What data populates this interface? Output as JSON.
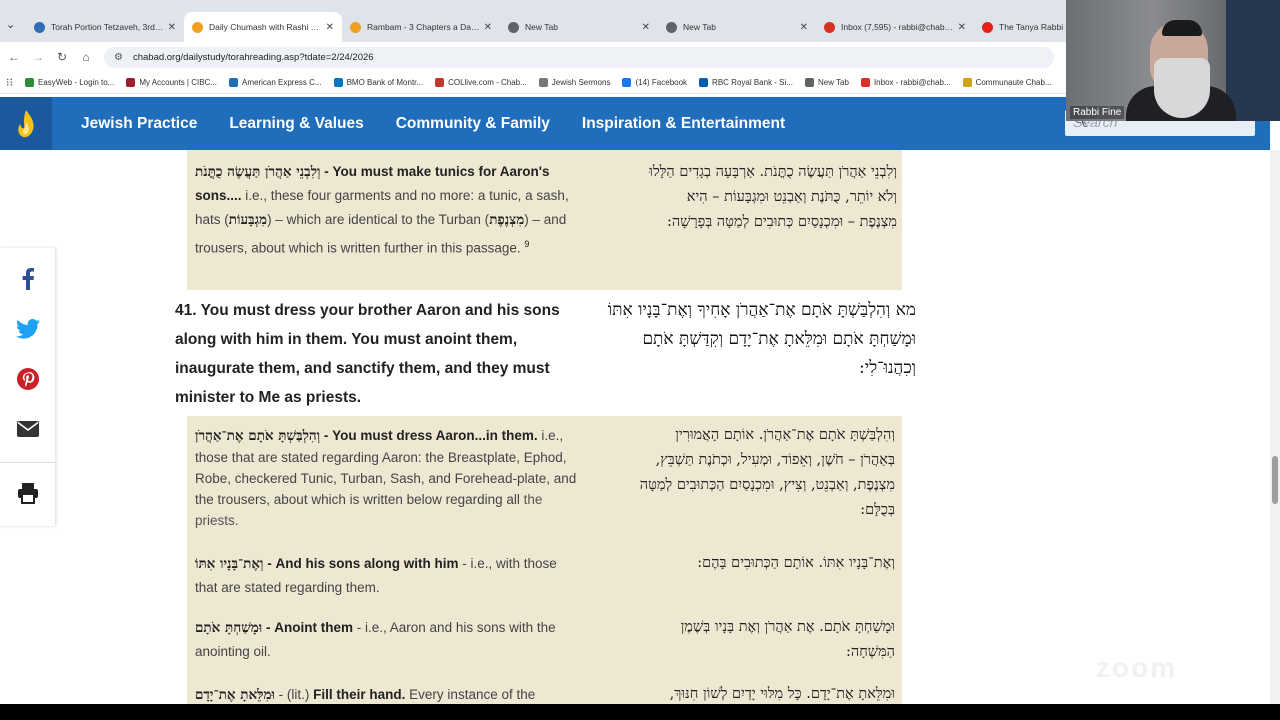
{
  "browser": {
    "tabs": [
      {
        "title": "Torah Portion Tetzaveh, 3rd Por",
        "fav_color": "#2f6db5",
        "active": false
      },
      {
        "title": "Daily Chumash with Rashi - Cha",
        "fav_color": "#f0a020",
        "active": true
      },
      {
        "title": "Rambam - 3 Chapters a Day - 1",
        "fav_color": "#f0a020",
        "active": false
      },
      {
        "title": "New Tab",
        "fav_color": "#5f6368",
        "active": false
      },
      {
        "title": "New Tab",
        "fav_color": "#5f6368",
        "active": false
      },
      {
        "title": "Inbox (7,595) - rabbi@chabad.",
        "fav_color": "#d93025",
        "active": false
      },
      {
        "title": "The Tanya Rabbi - Y",
        "fav_color": "#e62117",
        "active": false
      }
    ],
    "url": "chabad.org/dailystudy/torahreading.asp?tdate=2/24/2026",
    "bookmarks": [
      {
        "label": "EasyWeb - Login to...",
        "color": "#2e8b3b"
      },
      {
        "label": "My Accounts | CIBC...",
        "color": "#a01e2e"
      },
      {
        "label": "American Express C...",
        "color": "#1f6fb5"
      },
      {
        "label": "BMO Bank of Montr...",
        "color": "#0079c1"
      },
      {
        "label": "COLlive.com - Chab...",
        "color": "#c0392b"
      },
      {
        "label": "Jewish Sermons",
        "color": "#777777"
      },
      {
        "label": "(14) Facebook",
        "color": "#1877f2"
      },
      {
        "label": "RBC Royal Bank - Si...",
        "color": "#005daa"
      },
      {
        "label": "New Tab",
        "color": "#5f6368"
      },
      {
        "label": "Inbox - rabbi@chab...",
        "color": "#d93025"
      },
      {
        "label": "Communaute Chab...",
        "color": "#d4a017"
      }
    ]
  },
  "site": {
    "nav": [
      "Jewish Practice",
      "Learning & Values",
      "Community & Family",
      "Inspiration & Entertainment"
    ],
    "search_placeholder": "Search",
    "brand_color": "#1f6dbb"
  },
  "share": [
    "facebook-icon",
    "twitter-icon",
    "pinterest-icon",
    "email-icon",
    "print-icon"
  ],
  "content": {
    "c1_en_he": "וְלִבְנֵי אַהֲרֹן תַּעֲשֶׂה כֻתֳּנֹת",
    "c1_en_b": " - You must make tunics for Aaron's sons....",
    "c1_en_t1": " i.e., these four garments and no more: a tunic, a sash, hats (",
    "c1_en_he2": "מִגְבָּעוֹת",
    "c1_en_t2": ") – which are identical to the Turban (",
    "c1_en_he3": "מִצְנֶפֶת",
    "c1_en_t3": ") – and trousers, about which is written further in this passage.",
    "c1_en_fn": "9",
    "c1_he": "וְלִבְנֵי אַהֲרֹן תַּעֲשֶׂה כֻתֳּנֹת. אַרְבָּעָה בְגָדִים הַלָּלוּ וְלֹא יוֹתֵר, כֻּתֹּנֶת וְאַבְנֵט וּמִגְבָּעוֹת – הִיא מִצְנֶפֶת – וּמִכְנָסַיִם כְּתוּבִים לְמַטָּה בְּפָרָשָׁה:",
    "v41_en": "41.  You must dress your brother Aaron and his sons along with him in them. You must anoint them, inaugurate them, and sanctify them, and they must minister to Me as priests.",
    "v41_he": "מא  וְהִלְבַּשְׁתָּ אֹתָם אֶת־אַהֲרֹן אָחִיךָ וְאֶת־בָּנָיו אִתּוֹ וּמָשַׁחְתָּ אֹתָם וּמִלֵּאתָ אֶת־יָדָם וְקִדַּשְׁתָּ אֹתָם וְכִהֲנוּ־לִי:",
    "c2_en_he": "וְהִלְבַּשְׁתָּ אֹתָם אֶת־אַהֲרֹן",
    "c2_en_b": " - You must dress Aaron...in them.",
    "c2_en_t": " i.e., those that are stated regarding Aaron: the Breastplate, Ephod, Robe, checkered Tunic, Turban, Sash, and Forehead-plate, and the trousers, about which is written below regarding all",
    "c2_en_t2": " the priests.",
    "c2_he": "וְהִלְבַּשְׁתָּ אֹתָם אֶת־אַהֲרֹן. אוֹתָם הָאֲמוּרִין בְּאַהֲרֹן – חֹשֶׁן, וְאֵפוֹד, וּמְעִיל, וּכְתֹנֶת תַּשְׁבֵּץ, מִצְנֶפֶת, וְאַבְנֵט, וְצִיץ, וּמִכְנָסַיִם הַכְּתוּבִים לְמַטָּה בְּכֻלָּם:",
    "c3_en_he": "וְאֶת־בָּנָיו אִתּוֹ",
    "c3_en_b": " - And his sons along with him",
    "c3_en_t": " - i.e., with those that are stated regarding them.",
    "c3_he": "וְאֶת־בָּנָיו אִתּוֹ. אוֹתָם הַכְּתוּבִים בָּהֶם:",
    "c4_en_he": "וּמָשַׁחְתָּ אֹתָם",
    "c4_en_b": " - Anoint them",
    "c4_en_t": " - i.e., Aaron and his sons with the anointing oil.",
    "c4_he": "וּמָשַׁחְתָּ אֹתָם. אֶת אַהֲרֹן וְאֶת בָּנָיו בְּשֶׁמֶן הַמִּשְׁחָה:",
    "c5_en_he": "וּמִלֵּאתָ אֶת־יָדָם",
    "c5_en_t": " - (lit.) ",
    "c5_en_b": "Fill their hand.",
    "c5_en_t2": " Every instance of the",
    "c5_he": "וּמִלֵּאתָ אֶת־יָדָם. כָּל מִלּוּי יָדַיִם לְשׁוֹן חִנּוּךְ,"
  },
  "webcam": {
    "name": "Rabbi Fine"
  },
  "watermark": "zoom"
}
